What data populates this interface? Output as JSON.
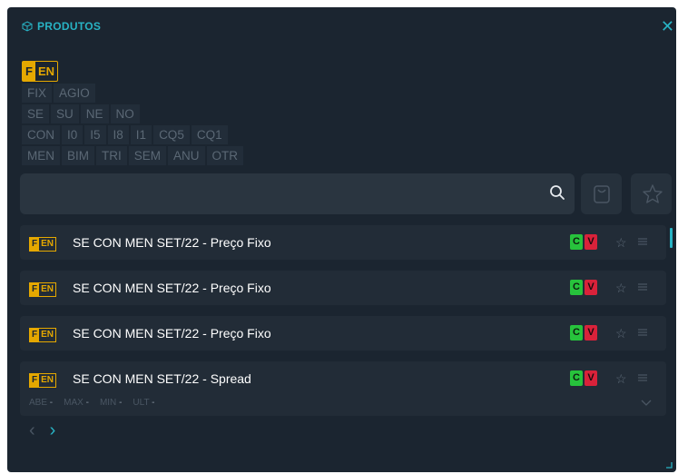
{
  "header": {
    "title": "PRODUTOS",
    "close_symbol": "✕"
  },
  "market_tag": {
    "f": "F",
    "en": "EN"
  },
  "filters": {
    "rows": [
      [
        "FIX",
        "AGIO"
      ],
      [
        "SE",
        "SU",
        "NE",
        "NO"
      ],
      [
        "CON",
        "I0",
        "I5",
        "I8",
        "I1",
        "CQ5",
        "CQ1"
      ],
      [
        "MEN",
        "BIM",
        "TRI",
        "SEM",
        "ANU",
        "OTR"
      ]
    ]
  },
  "search": {
    "value": "",
    "placeholder": ""
  },
  "products": [
    {
      "tag_f": "F",
      "tag_en": "EN",
      "name": "SE CON MEN SET/22 - Preço Fixo",
      "buy": "C",
      "sell": "V"
    },
    {
      "tag_f": "F",
      "tag_en": "EN",
      "name": "SE CON MEN SET/22 - Preço Fixo",
      "buy": "C",
      "sell": "V"
    },
    {
      "tag_f": "F",
      "tag_en": "EN",
      "name": "SE CON MEN SET/22 - Preço Fixo",
      "buy": "C",
      "sell": "V"
    },
    {
      "tag_f": "F",
      "tag_en": "EN",
      "name": "SE CON MEN SET/22 - Spread",
      "buy": "C",
      "sell": "V",
      "metrics": [
        {
          "label": "ABE",
          "value": "-"
        },
        {
          "label": "MAX",
          "value": "-"
        },
        {
          "label": "MIN",
          "value": "-"
        },
        {
          "label": "ULT",
          "value": "-"
        }
      ]
    }
  ],
  "pager": {
    "prev": "‹",
    "next": "›"
  },
  "colors": {
    "accent": "#28b3c4",
    "tag": "#e5a800",
    "buy": "#27c33c",
    "sell": "#d9223a",
    "panel": "#1b2530"
  },
  "icons": [
    "cube-icon",
    "close-icon",
    "search-icon",
    "cart-icon",
    "star-icon",
    "menu-icon",
    "chevron-down-icon",
    "chevron-left-icon",
    "chevron-right-icon"
  ]
}
